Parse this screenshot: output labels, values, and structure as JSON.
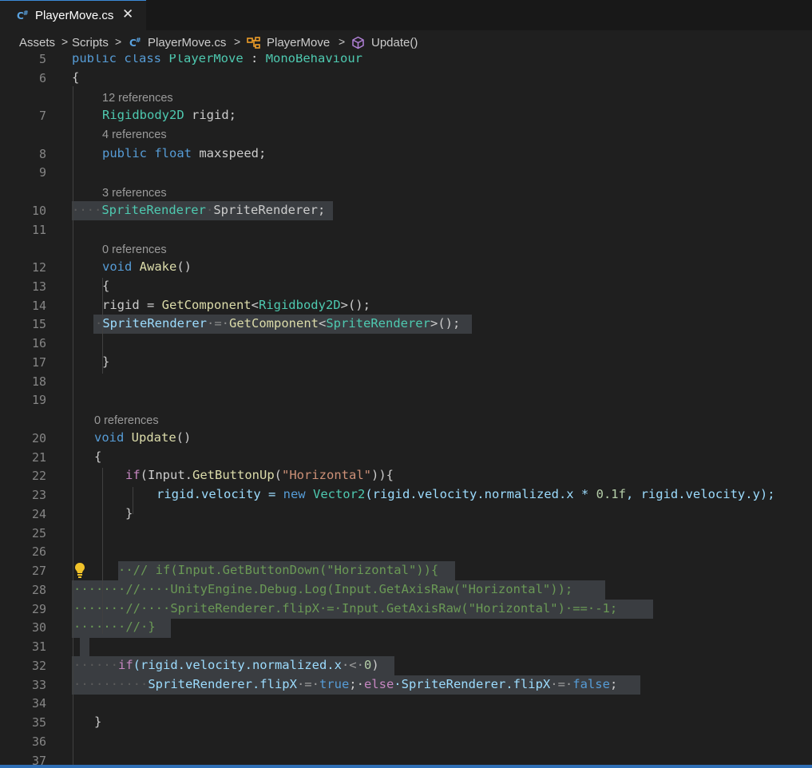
{
  "tab": {
    "label": "PlayerMove.cs",
    "close": "✕",
    "icon": "csharp-file-icon"
  },
  "breadcrumb": {
    "items": [
      "Assets",
      "Scripts",
      "PlayerMove.cs",
      "PlayerMove",
      "Update()"
    ],
    "separator": ">"
  },
  "lines": {
    "n5": "5",
    "n6": "6",
    "n7": "7",
    "n8": "8",
    "n9": "9",
    "n10": "10",
    "n11": "11",
    "n12": "12",
    "n13": "13",
    "n14": "14",
    "n15": "15",
    "n16": "16",
    "n17": "17",
    "n18": "18",
    "n19": "19",
    "n20": "20",
    "n21": "21",
    "n22": "22",
    "n23": "23",
    "n24": "24",
    "n25": "25",
    "n26": "26",
    "n27": "27",
    "n28": "28",
    "n29": "29",
    "n30": "30",
    "n31": "31",
    "n32": "32",
    "n33": "33",
    "n34": "34",
    "n35": "35",
    "n36": "36",
    "n37": "37"
  },
  "codelens": {
    "rigid": "12 references",
    "maxspeed": "4 references",
    "spriteRenderer": "3 references",
    "awake": "0 references",
    "update": "0 references"
  },
  "code": {
    "l5": {
      "kw1": "public",
      "kw2": "class",
      "name": "PlayerMove",
      "colon": " : ",
      "base": "MonoBehaviour"
    },
    "l6": "{",
    "l7": {
      "type": "Rigidbody2D",
      "rest": " rigid;"
    },
    "l8": {
      "kw1": "public",
      "kw2": "float",
      "rest": " maxspeed;"
    },
    "l10": {
      "ws": "····",
      "type": "SpriteRenderer",
      "dot": "·",
      "rest": "SpriteRenderer;"
    },
    "l12": {
      "kw": "void",
      "fn": "Awake",
      "rest": "()"
    },
    "l13": "{",
    "l14": {
      "a": "rigid = ",
      "fn": "GetComponent",
      "b": "<",
      "type": "Rigidbody2D",
      "c": ">();"
    },
    "l15": {
      "ws": "·",
      "a": "SpriteRenderer",
      "b": "·=·",
      "fn": "GetComponent",
      "c": "<",
      "type": "SpriteRenderer",
      "d": ">();"
    },
    "l17": "}",
    "l20": {
      "kw": "void",
      "fn": "Update",
      "rest": "()"
    },
    "l21": "{",
    "l22": {
      "kw": "if",
      "a": "(Input.",
      "fn": "GetButtonUp",
      "b": "(",
      "str": "\"Horizontal\"",
      "c": ")){"
    },
    "l23": {
      "a": "rigid.velocity = ",
      "kw": "new",
      "type": "Vector2",
      "b": "(rigid.velocity.normalized.x * ",
      "num": "0.1f",
      "c": ", rigid.velocity.y);"
    },
    "l24": "}",
    "l27": "··// if(Input.GetButtonDown(\"Horizontal\")){",
    "l28": "·······//····UnityEngine.Debug.Log(Input.GetAxisRaw(\"Horizontal\"));",
    "l29": "·······//····SpriteRenderer.flipX·=·Input.GetAxisRaw(\"Horizontal\")·==·-1;",
    "l30": "·······//·}",
    "l32": {
      "ws": "······",
      "kw": "if",
      "a": "(rigid.velocity.normalized.x",
      "b": "·<·",
      "num": "0",
      "c": ")"
    },
    "l33": {
      "ws": "··········",
      "a": "SpriteRenderer.flipX",
      "b": "·=·",
      "kw1": "true",
      "c": ";·",
      "kw2": "else",
      "d": "·SpriteRenderer.flipX",
      "e": "·=·",
      "kw3": "false",
      "f": ";"
    },
    "l35": "}"
  },
  "colors": {
    "keyword": "#569cd6",
    "type": "#4ec9b0",
    "function": "#dcdcaa",
    "string": "#ce9178",
    "number": "#b5cea8",
    "comment": "#6a9955",
    "selection": "#3a3d41"
  },
  "icons": {
    "bulb": "lightbulb-icon",
    "class": "class-symbol-icon",
    "method": "method-cube-icon"
  }
}
